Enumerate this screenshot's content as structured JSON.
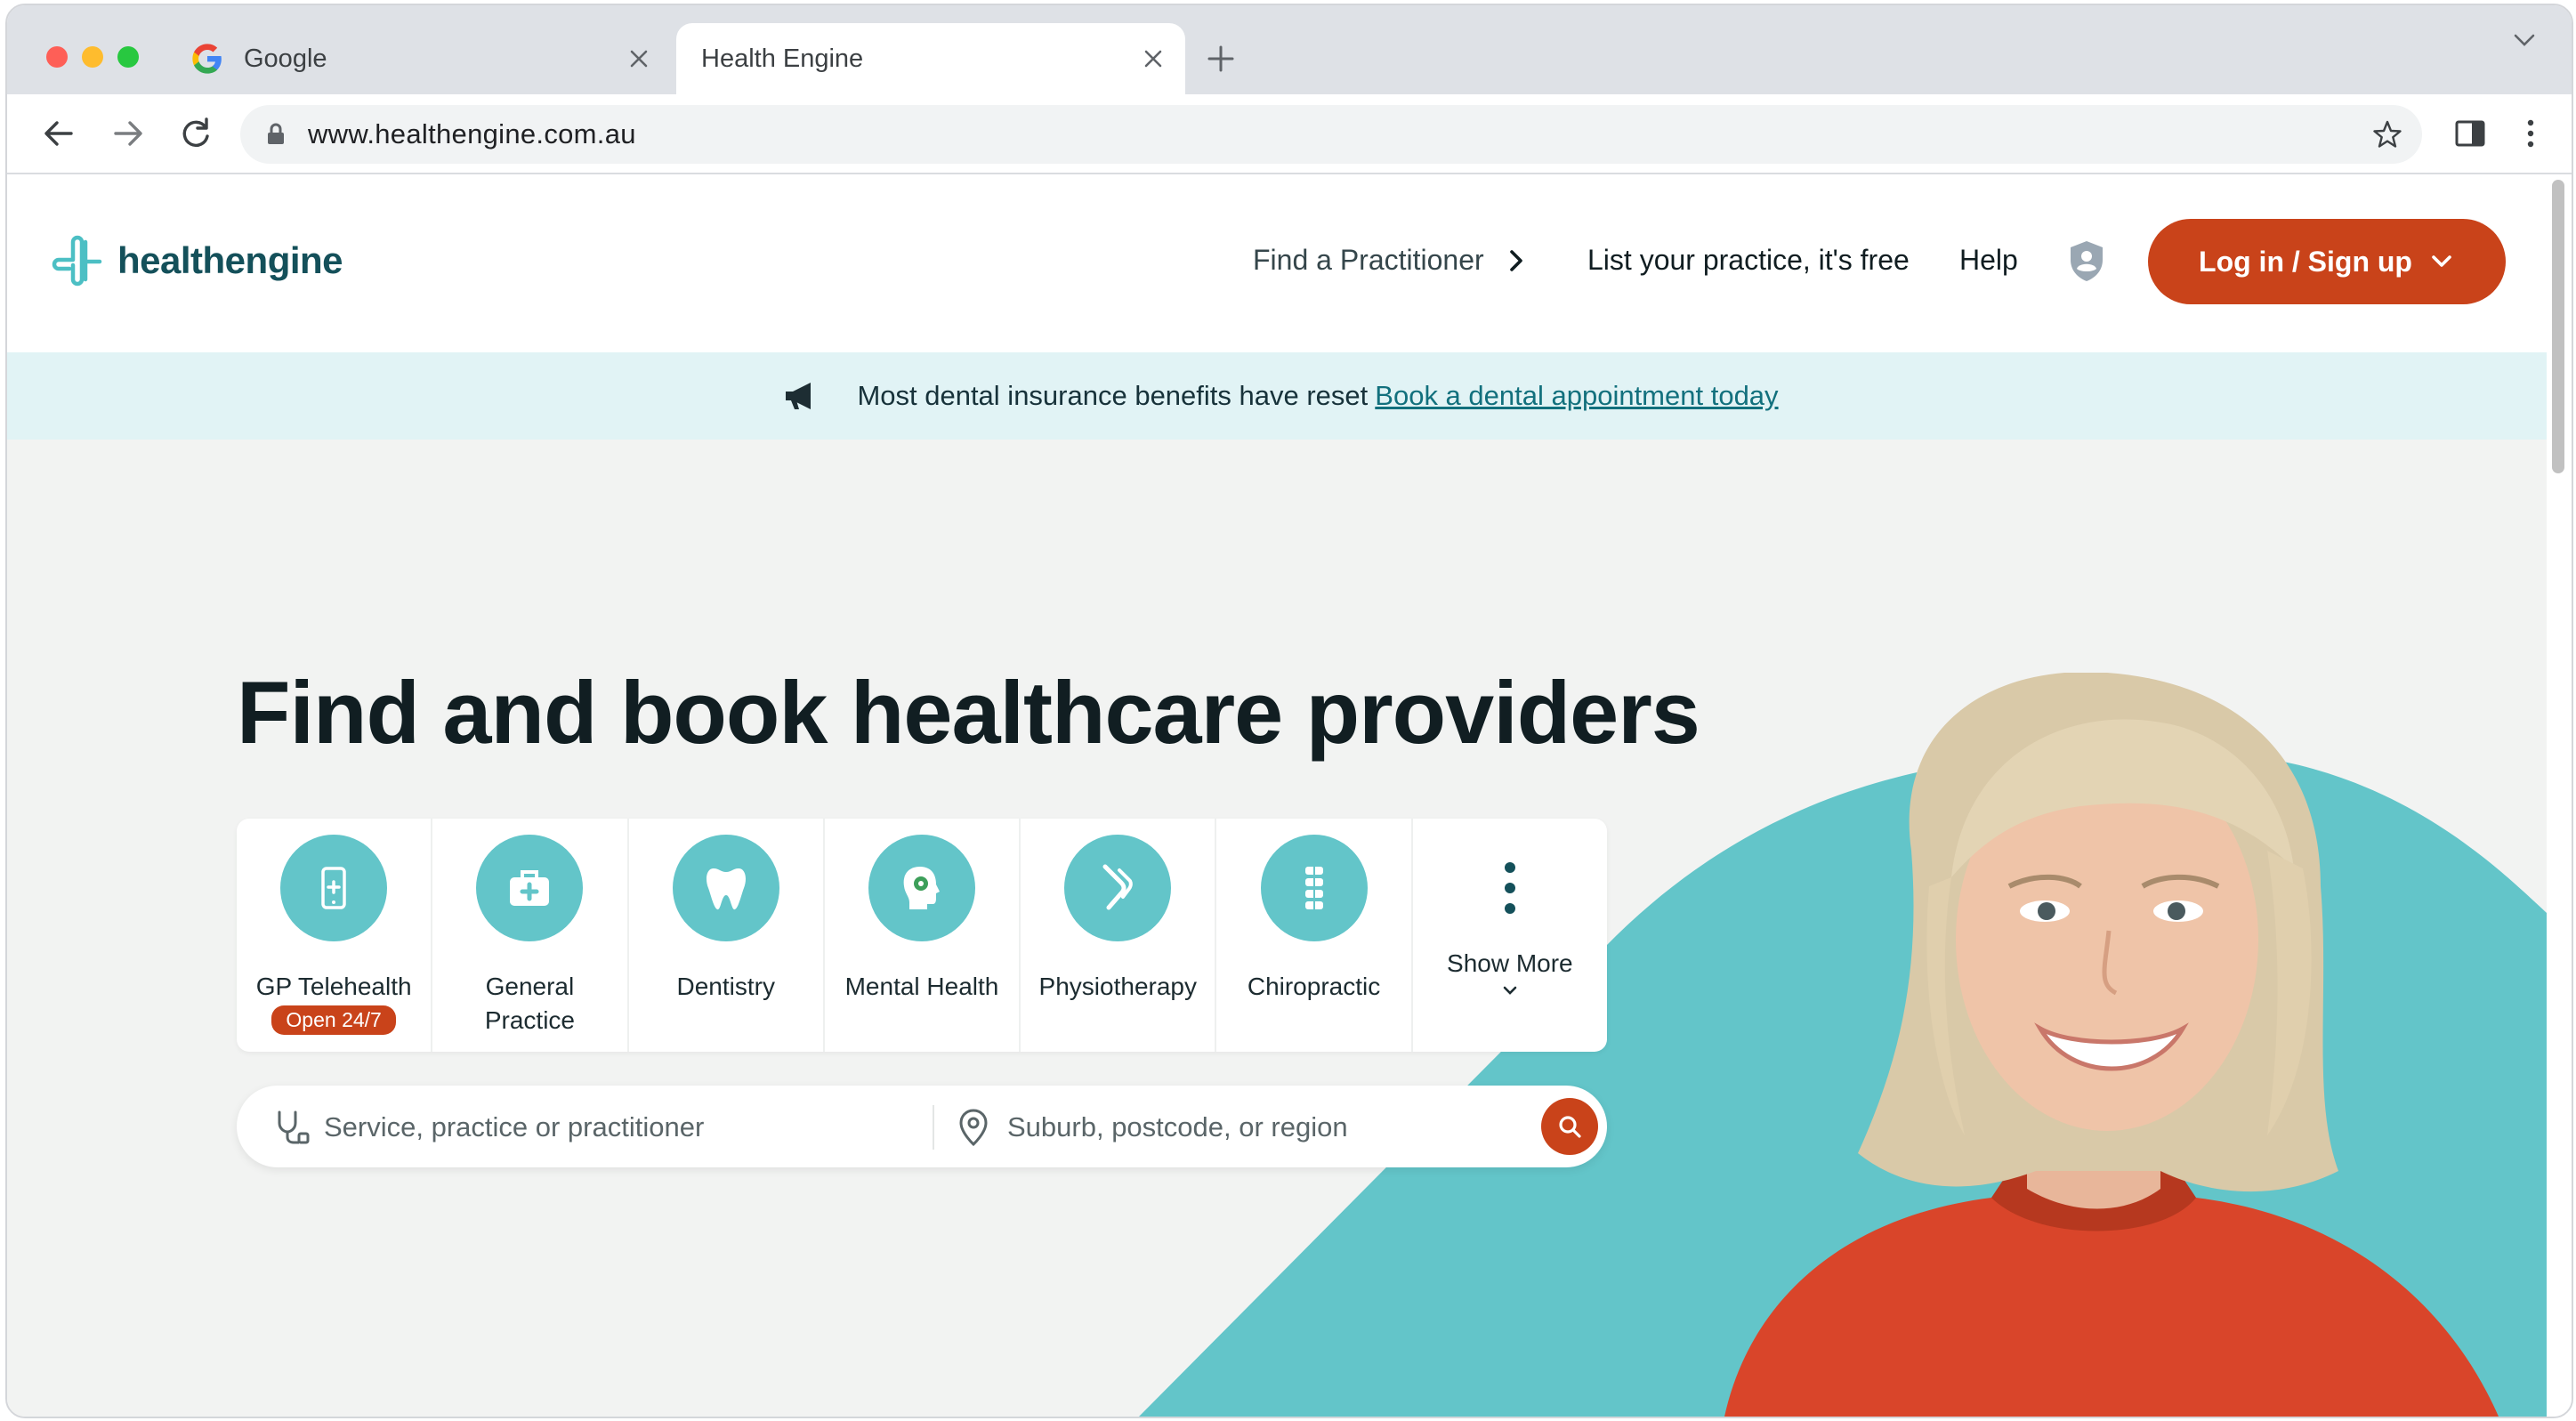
{
  "browser": {
    "tabs": [
      {
        "title": "Google",
        "active": false
      },
      {
        "title": "Health Engine",
        "active": true
      }
    ],
    "url": "www.healthengine.com.au"
  },
  "header": {
    "logo_text": "healthengine",
    "nav": {
      "find_practitioner": "Find a Practitioner",
      "list_practice": "List your practice, it's free",
      "help": "Help"
    },
    "login_label": "Log in / Sign up"
  },
  "banner": {
    "text": "Most dental insurance benefits have reset",
    "link": "Book a dental appointment today"
  },
  "hero": {
    "title": "Find and book healthcare providers",
    "categories": [
      {
        "label": "GP Telehealth",
        "badge": "Open 24/7",
        "icon": "phone-plus-icon"
      },
      {
        "label": "General\nPractice",
        "icon": "medical-bag-icon"
      },
      {
        "label": "Dentistry",
        "icon": "tooth-icon"
      },
      {
        "label": "Mental Health",
        "icon": "head-brain-icon"
      },
      {
        "label": "Physiotherapy",
        "icon": "joint-icon"
      },
      {
        "label": "Chiropractic",
        "icon": "spine-icon"
      },
      {
        "label": "Show More",
        "icon": "vertical-dots-icon"
      }
    ],
    "search": {
      "service_placeholder": "Service, practice or practitioner",
      "location_placeholder": "Suburb, postcode, or region"
    }
  },
  "colors": {
    "brand_teal": "#63c5c9",
    "brand_orange": "#c9431a",
    "banner_bg": "#e1f3f5",
    "page_bg": "#f2f3f2"
  }
}
